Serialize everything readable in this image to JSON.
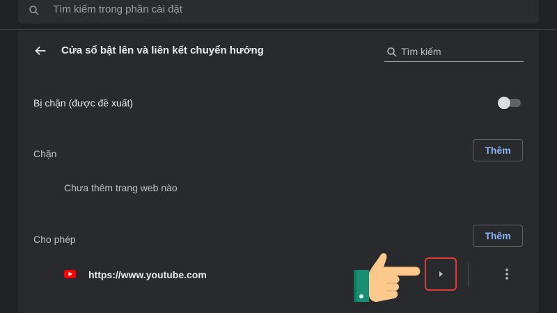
{
  "top_search": {
    "placeholder": "Tìm kiếm trong phần cài đặt",
    "icon": "search-icon"
  },
  "header": {
    "title": "Cửa sổ bật lên và liên kết chuyển hướng",
    "back_icon": "arrow-left-icon",
    "search_placeholder": "Tìm kiếm"
  },
  "default_setting": {
    "label": "Bị chặn (được đề xuất)",
    "toggle_on": false
  },
  "block_section": {
    "label": "Chặn",
    "add_label": "Thêm",
    "empty_text": "Chưa thêm trang web nào"
  },
  "allow_section": {
    "label": "Cho phép",
    "add_label": "Thêm",
    "sites": [
      {
        "url": "https://www.youtube.com",
        "icon": "youtube-icon"
      }
    ]
  },
  "colors": {
    "accent": "#8ab4f8",
    "highlight_border": "#e53935",
    "background": "#202124",
    "card": "#292a2d"
  }
}
